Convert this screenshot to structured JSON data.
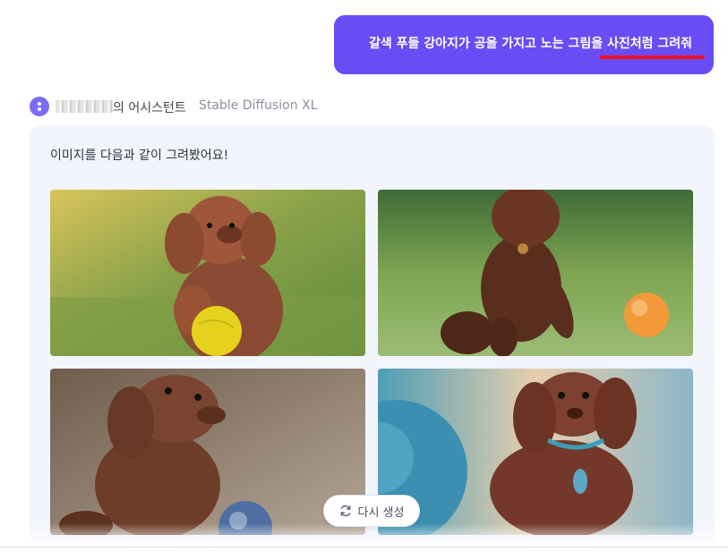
{
  "user_message": {
    "text": "갈색 푸들 강아지가 공을 가지고 노는 그림을 사진처럼 그려줘"
  },
  "assistant": {
    "name": "의 어시스턴트",
    "model": "Stable Diffusion XL",
    "reply": "이미지를 다음과 같이 그려봤어요!"
  },
  "images": [
    {
      "name": "generated-image-1",
      "subject": "brown poodle with yellow ball"
    },
    {
      "name": "generated-image-2",
      "subject": "brown poodle with orange ball"
    },
    {
      "name": "generated-image-3",
      "subject": "brown poodle with blue ball"
    },
    {
      "name": "generated-image-4",
      "subject": "brown poodle with blue ball and collar"
    }
  ],
  "regenerate": {
    "label": "다시 생성",
    "icon": "refresh-icon"
  },
  "colors": {
    "user_bubble": "#6a4cf5",
    "highlight": "#ff1020",
    "card_bg": "#f2f5fc",
    "avatar": "#7c6cf5"
  }
}
